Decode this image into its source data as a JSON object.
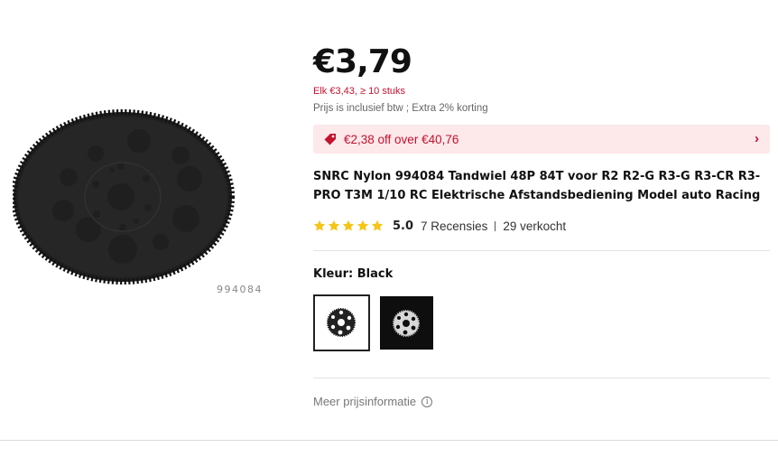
{
  "product_image": {
    "model_code": "994084"
  },
  "price": {
    "current": "€3,79",
    "bulk": "Elk €3,43, ≥ 10 stuks",
    "vat_note": "Prijs is inclusief btw ; Extra 2% korting"
  },
  "coupon": {
    "text": "€2,38 off over €40,76",
    "icon": "tag-icon",
    "color": "#c4122f",
    "background": "#fde8ea"
  },
  "title": "SNRC Nylon 994084 Tandwiel 48P 84T voor R2 R2-G R3-G R3-CR R3-PRO T3M 1/10 RC Elektrische Afstandsbediening Model auto Racing",
  "rating": {
    "stars": 5,
    "value": "5.0",
    "reviews": "7 Recensies",
    "sold": "29 verkocht",
    "star_color": "#f5c518"
  },
  "color": {
    "label": "Kleur: ",
    "selected": "Black"
  },
  "more_info": "Meer prijsinformatie"
}
